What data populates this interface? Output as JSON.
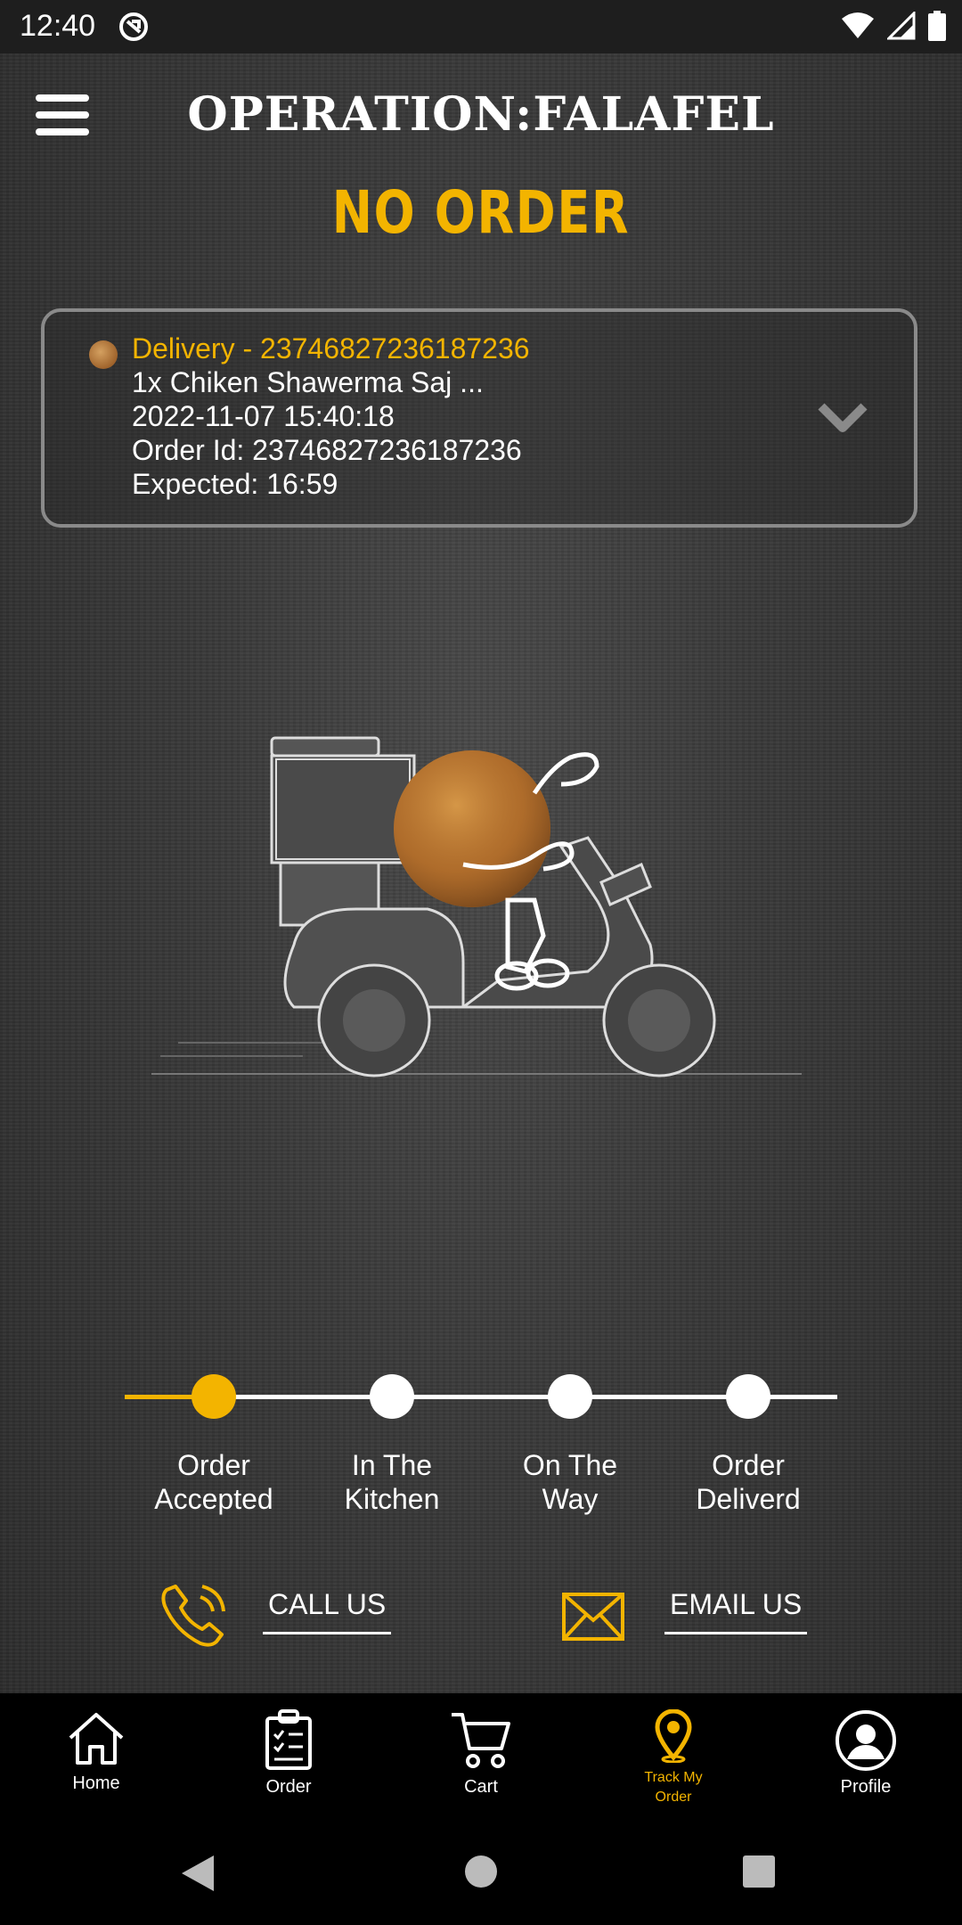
{
  "status_bar": {
    "time": "12:40"
  },
  "header": {
    "brand": "OPERATION:FALAFEL",
    "title": "NO ORDER"
  },
  "order": {
    "heading": "Delivery - 23746827236187236",
    "items": "1x Chiken Shawerma Saj ...",
    "datetime": "2022-11-07 15:40:18",
    "order_id": "Order Id: 23746827236187236",
    "expected": "Expected: 16:59"
  },
  "progress": {
    "current_step": 1,
    "steps": [
      {
        "line1": "Order",
        "line2": "Accepted"
      },
      {
        "line1": "In The",
        "line2": "Kitchen"
      },
      {
        "line1": "On The",
        "line2": "Way"
      },
      {
        "line1": "Order",
        "line2": "Deliverd"
      }
    ]
  },
  "contact": {
    "call_label": "CALL US",
    "email_label": "EMAIL US"
  },
  "nav": {
    "items": [
      {
        "label": "Home",
        "icon": "home-icon"
      },
      {
        "label": "Order",
        "icon": "clipboard-icon"
      },
      {
        "label": "Cart",
        "icon": "cart-icon"
      },
      {
        "label": "Track My Order",
        "icon": "location-pin-icon",
        "active": true
      },
      {
        "label": "Profile",
        "icon": "profile-icon"
      }
    ]
  },
  "colors": {
    "accent": "#f3b400",
    "nav_bg": "#000000",
    "card_border": "#8a8a8a"
  }
}
